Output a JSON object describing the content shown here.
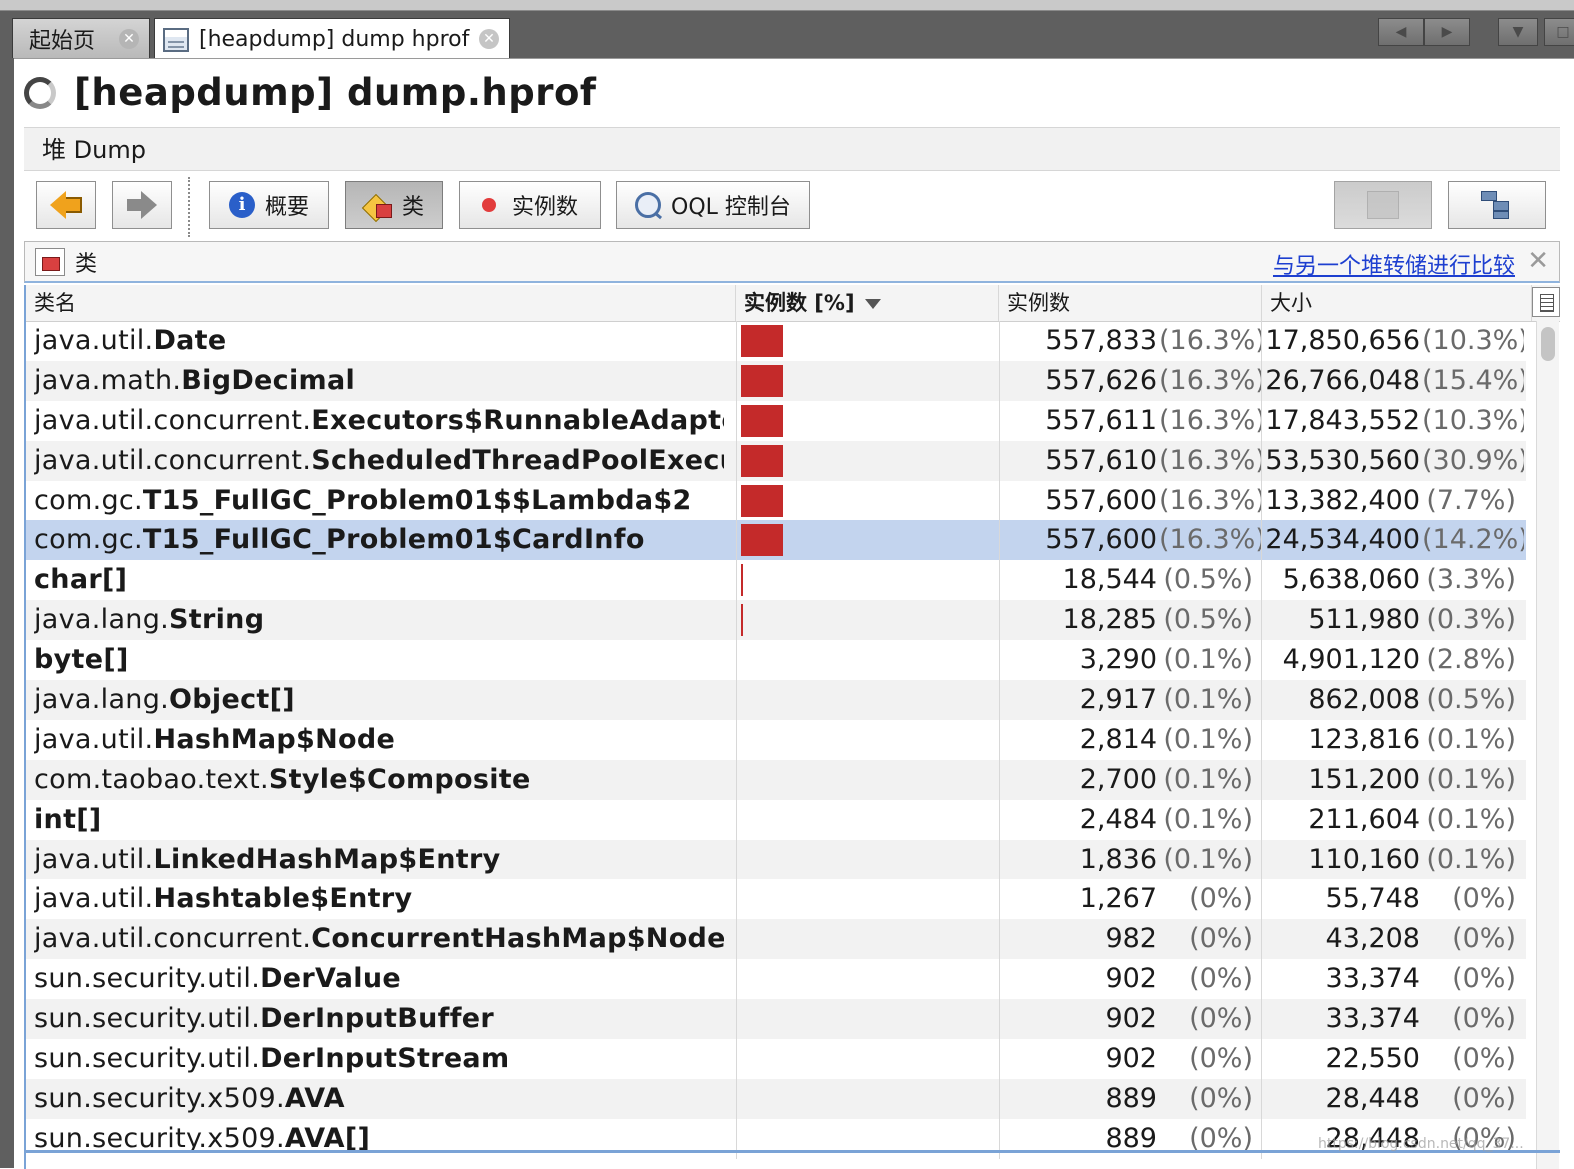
{
  "tabs": [
    {
      "label": "起始页",
      "active": false
    },
    {
      "label": "[heapdump] dump hprof",
      "active": true
    }
  ],
  "window_nav": {
    "left": "◀",
    "right": "▶",
    "menu": "▼",
    "maximize": "□"
  },
  "page_title": "[heapdump] dump.hprof",
  "section_header": "堆 Dump",
  "toolbar": {
    "summary_label": "概要",
    "classes_label": "类",
    "instances_label": "实例数",
    "oql_label": "OQL 控制台"
  },
  "classes_panel": {
    "title": "类",
    "compare_link": "与另一个堆转储进行比较",
    "close": "✕"
  },
  "table": {
    "columns": [
      "类名",
      "实例数 [%]",
      "实例数",
      "大小"
    ],
    "sorted_column": "实例数 [%]",
    "rows": [
      {
        "pkg": "java.util.",
        "cls": "Date",
        "bar_percent": 16.3,
        "count": "557,833",
        "count_pct": "(16.3%)",
        "size": "17,850,656",
        "size_pct": "(10.3%)"
      },
      {
        "pkg": "java.math.",
        "cls": "BigDecimal",
        "bar_percent": 16.3,
        "count": "557,626",
        "count_pct": "(16.3%)",
        "size": "26,766,048",
        "size_pct": "(15.4%)"
      },
      {
        "pkg": "java.util.concurrent.",
        "cls": "Executors$RunnableAdapter",
        "bar_percent": 16.3,
        "count": "557,611",
        "count_pct": "(16.3%)",
        "size": "17,843,552",
        "size_pct": "(10.3%)"
      },
      {
        "pkg": "java.util.concurrent.",
        "cls": "ScheduledThreadPoolExecutor...",
        "bar_percent": 16.3,
        "count": "557,610",
        "count_pct": "(16.3%)",
        "size": "53,530,560",
        "size_pct": "(30.9%)"
      },
      {
        "pkg": "com.gc.",
        "cls": "T15_FullGC_Problem01$$Lambda$2",
        "bar_percent": 16.3,
        "count": "557,600",
        "count_pct": "(16.3%)",
        "size": "13,382,400",
        "size_pct": "(7.7%)"
      },
      {
        "pkg": "com.gc.",
        "cls": "T15_FullGC_Problem01$CardInfo",
        "bar_percent": 16.3,
        "count": "557,600",
        "count_pct": "(16.3%)",
        "size": "24,534,400",
        "size_pct": "(14.2%)",
        "selected": true
      },
      {
        "pkg": "",
        "cls": "char[]",
        "bar_percent": 0.5,
        "count": "18,544",
        "count_pct": "(0.5%)",
        "size": "5,638,060",
        "size_pct": "(3.3%)"
      },
      {
        "pkg": "java.lang.",
        "cls": "String",
        "bar_percent": 0.5,
        "count": "18,285",
        "count_pct": "(0.5%)",
        "size": "511,980",
        "size_pct": "(0.3%)"
      },
      {
        "pkg": "",
        "cls": "byte[]",
        "bar_percent": 0.1,
        "count": "3,290",
        "count_pct": "(0.1%)",
        "size": "4,901,120",
        "size_pct": "(2.8%)"
      },
      {
        "pkg": "java.lang.",
        "cls": "Object[]",
        "bar_percent": 0.1,
        "count": "2,917",
        "count_pct": "(0.1%)",
        "size": "862,008",
        "size_pct": "(0.5%)"
      },
      {
        "pkg": "java.util.",
        "cls": "HashMap$Node",
        "bar_percent": 0.1,
        "count": "2,814",
        "count_pct": "(0.1%)",
        "size": "123,816",
        "size_pct": "(0.1%)"
      },
      {
        "pkg": "com.taobao.text.",
        "cls": "Style$Composite",
        "bar_percent": 0.1,
        "count": "2,700",
        "count_pct": "(0.1%)",
        "size": "151,200",
        "size_pct": "(0.1%)"
      },
      {
        "pkg": "",
        "cls": "int[]",
        "bar_percent": 0.1,
        "count": "2,484",
        "count_pct": "(0.1%)",
        "size": "211,604",
        "size_pct": "(0.1%)"
      },
      {
        "pkg": "java.util.",
        "cls": "LinkedHashMap$Entry",
        "bar_percent": 0.1,
        "count": "1,836",
        "count_pct": "(0.1%)",
        "size": "110,160",
        "size_pct": "(0.1%)"
      },
      {
        "pkg": "java.util.",
        "cls": "Hashtable$Entry",
        "bar_percent": 0,
        "count": "1,267",
        "count_pct": "(0%)",
        "size": "55,748",
        "size_pct": "(0%)"
      },
      {
        "pkg": "java.util.concurrent.",
        "cls": "ConcurrentHashMap$Node",
        "bar_percent": 0,
        "count": "982",
        "count_pct": "(0%)",
        "size": "43,208",
        "size_pct": "(0%)"
      },
      {
        "pkg": "sun.security.util.",
        "cls": "DerValue",
        "bar_percent": 0,
        "count": "902",
        "count_pct": "(0%)",
        "size": "33,374",
        "size_pct": "(0%)"
      },
      {
        "pkg": "sun.security.util.",
        "cls": "DerInputBuffer",
        "bar_percent": 0,
        "count": "902",
        "count_pct": "(0%)",
        "size": "33,374",
        "size_pct": "(0%)"
      },
      {
        "pkg": "sun.security.util.",
        "cls": "DerInputStream",
        "bar_percent": 0,
        "count": "902",
        "count_pct": "(0%)",
        "size": "22,550",
        "size_pct": "(0%)"
      },
      {
        "pkg": "sun.security.x509.",
        "cls": "AVA",
        "bar_percent": 0,
        "count": "889",
        "count_pct": "(0%)",
        "size": "28,448",
        "size_pct": "(0%)"
      },
      {
        "pkg": "sun.security.x509.",
        "cls": "AVA[]",
        "bar_percent": 0,
        "count": "889",
        "count_pct": "(0%)",
        "size": "28,448",
        "size_pct": "(0%)"
      }
    ]
  },
  "colors": {
    "bar": "#c42a2a",
    "selected_row": "#c3d4ee",
    "link": "#1d3fd0"
  },
  "watermark": "https://blog.csdn.net/qq_37..."
}
